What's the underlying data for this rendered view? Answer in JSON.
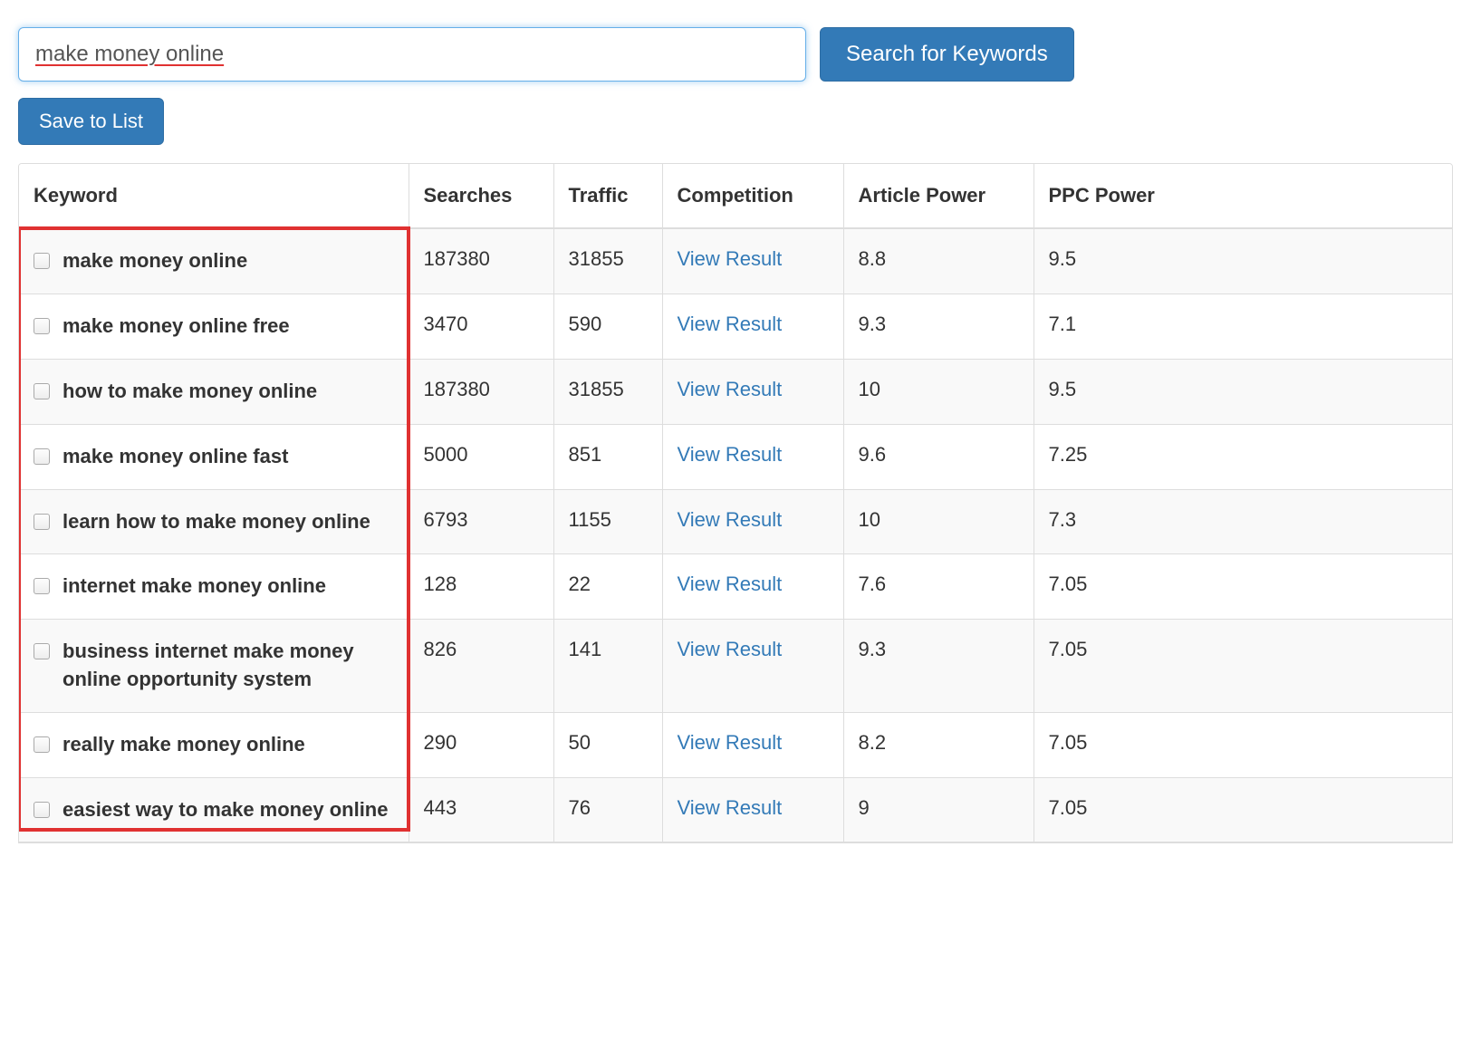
{
  "search": {
    "value": "make money online",
    "button_label": "Search for Keywords"
  },
  "save_button_label": "Save to List",
  "columns": {
    "keyword": "Keyword",
    "searches": "Searches",
    "traffic": "Traffic",
    "competition": "Competition",
    "article_power": "Article Power",
    "ppc_power": "PPC Power"
  },
  "competition_link_label": "View Result",
  "rows": [
    {
      "keyword": "make money online",
      "searches": "187380",
      "traffic": "31855",
      "article_power": "8.8",
      "ppc_power": "9.5"
    },
    {
      "keyword": "make money online free",
      "searches": "3470",
      "traffic": "590",
      "article_power": "9.3",
      "ppc_power": "7.1"
    },
    {
      "keyword": "how to make money online",
      "searches": "187380",
      "traffic": "31855",
      "article_power": "10",
      "ppc_power": "9.5"
    },
    {
      "keyword": "make money online fast",
      "searches": "5000",
      "traffic": "851",
      "article_power": "9.6",
      "ppc_power": "7.25"
    },
    {
      "keyword": "learn how to make money online",
      "searches": "6793",
      "traffic": "1155",
      "article_power": "10",
      "ppc_power": "7.3"
    },
    {
      "keyword": "internet make money online",
      "searches": "128",
      "traffic": "22",
      "article_power": "7.6",
      "ppc_power": "7.05"
    },
    {
      "keyword": "business internet make money online opportunity system",
      "searches": "826",
      "traffic": "141",
      "article_power": "9.3",
      "ppc_power": "7.05"
    },
    {
      "keyword": "really make money online",
      "searches": "290",
      "traffic": "50",
      "article_power": "8.2",
      "ppc_power": "7.05"
    },
    {
      "keyword": "easiest way to make money online",
      "searches": "443",
      "traffic": "76",
      "article_power": "9",
      "ppc_power": "7.05"
    }
  ]
}
